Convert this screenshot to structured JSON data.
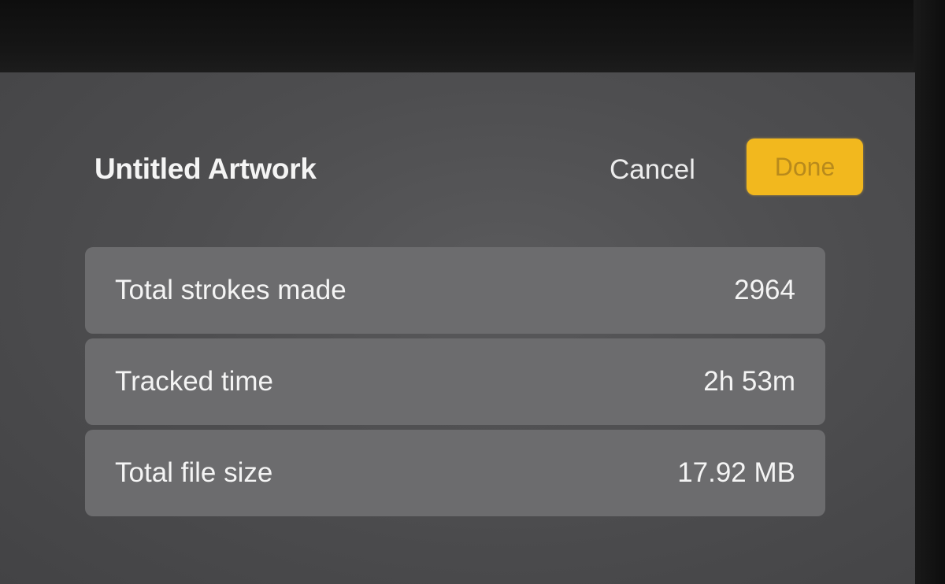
{
  "header": {
    "title": "Untitled Artwork",
    "cancel_label": "Cancel",
    "done_label": "Done"
  },
  "stats": [
    {
      "label": "Total strokes made",
      "value": "2964"
    },
    {
      "label": "Tracked time",
      "value": "2h 53m"
    },
    {
      "label": "Total file size",
      "value": "17.92 MB"
    }
  ],
  "colors": {
    "accent": "#f2b81e",
    "panel": "#4e4e50",
    "row": "#6c6c6e"
  }
}
